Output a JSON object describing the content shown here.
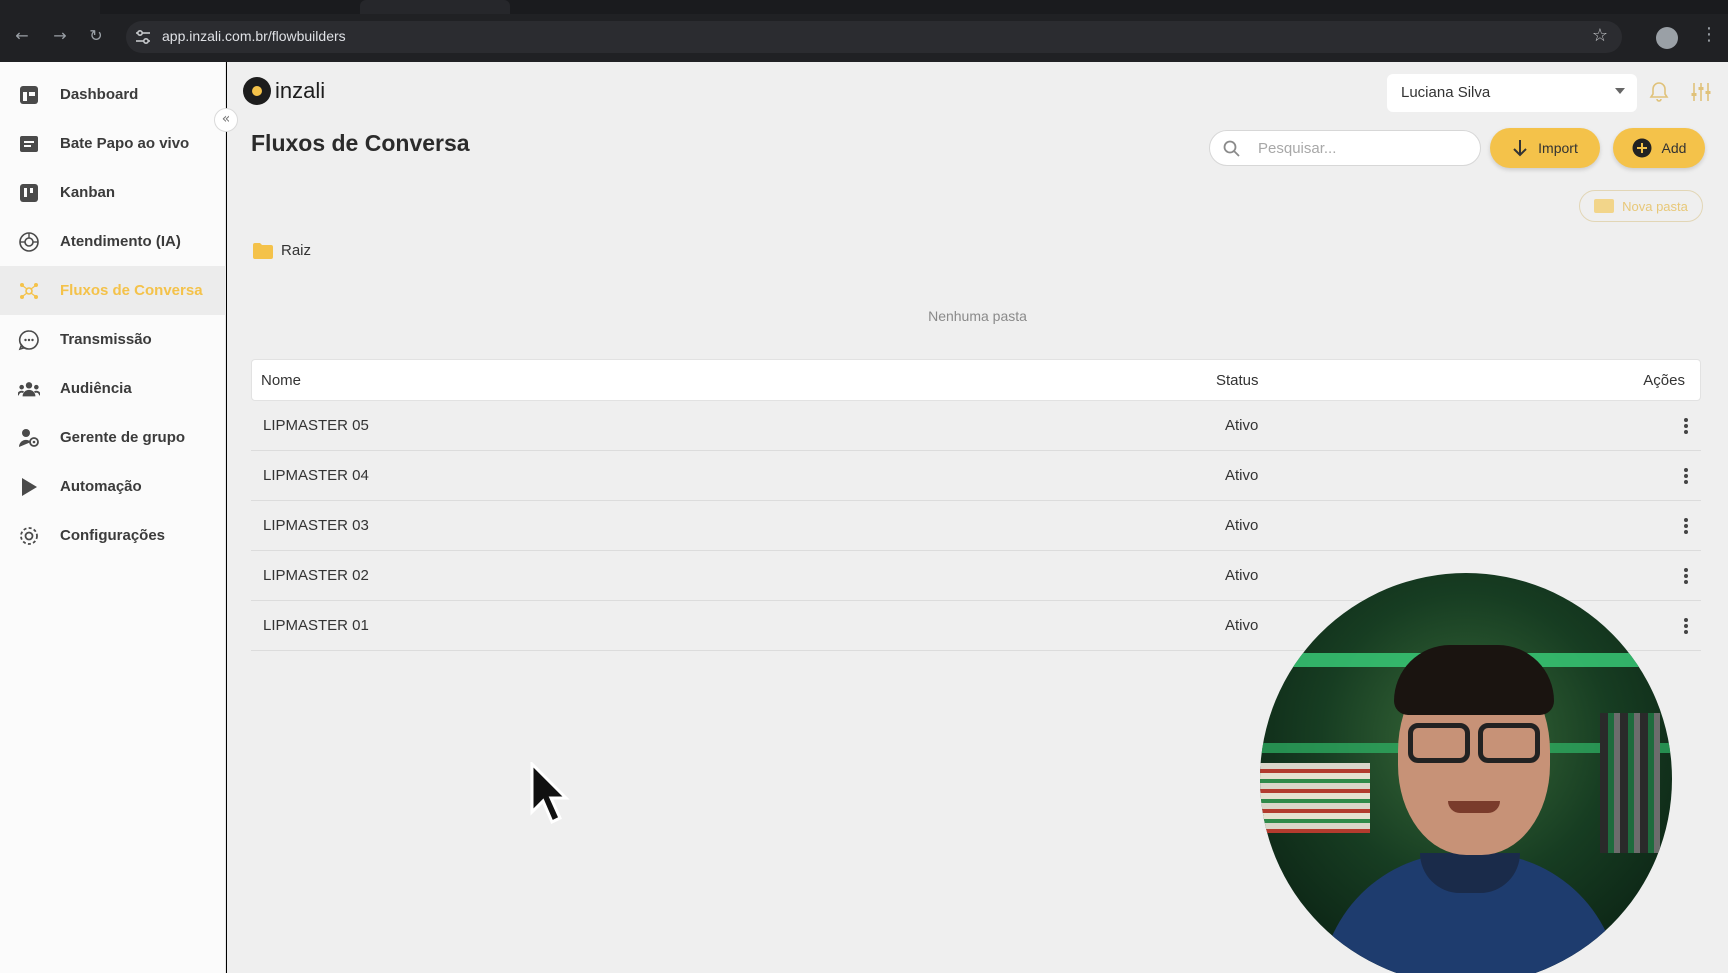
{
  "browser": {
    "url": "app.inzali.com.br/flowbuilders"
  },
  "app": {
    "logo_text": "inzali",
    "user_name": "Luciana Silva",
    "accent_color": "#f4c24a"
  },
  "sidebar": {
    "items": [
      {
        "label": "Dashboard",
        "icon": "dashboard-icon",
        "active": false
      },
      {
        "label": "Bate Papo ao vivo",
        "icon": "chat-icon",
        "active": false
      },
      {
        "label": "Kanban",
        "icon": "kanban-icon",
        "active": false
      },
      {
        "label": "Atendimento (IA)",
        "icon": "brain-icon",
        "active": false
      },
      {
        "label": "Fluxos de Conversa",
        "icon": "flow-icon",
        "active": true
      },
      {
        "label": "Transmissão",
        "icon": "broadcast-icon",
        "active": false
      },
      {
        "label": "Audiência",
        "icon": "audience-icon",
        "active": false
      },
      {
        "label": "Gerente de grupo",
        "icon": "group-manager-icon",
        "active": false
      },
      {
        "label": "Automação",
        "icon": "play-icon",
        "active": false
      },
      {
        "label": "Configurações",
        "icon": "gear-icon",
        "active": false
      }
    ]
  },
  "main": {
    "title": "Fluxos de Conversa",
    "search_placeholder": "Pesquisar...",
    "import_label": "Import",
    "add_label": "Add",
    "new_folder_label": "Nova pasta",
    "breadcrumb_root": "Raiz",
    "empty_folders": "Nenhuma pasta",
    "table": {
      "columns": [
        "Nome",
        "Status",
        "Ações"
      ],
      "rows": [
        {
          "name": "LIPMASTER 05",
          "status": "Ativo"
        },
        {
          "name": "LIPMASTER 04",
          "status": "Ativo"
        },
        {
          "name": "LIPMASTER 03",
          "status": "Ativo"
        },
        {
          "name": "LIPMASTER 02",
          "status": "Ativo"
        },
        {
          "name": "LIPMASTER 01",
          "status": "Ativo"
        }
      ]
    }
  }
}
